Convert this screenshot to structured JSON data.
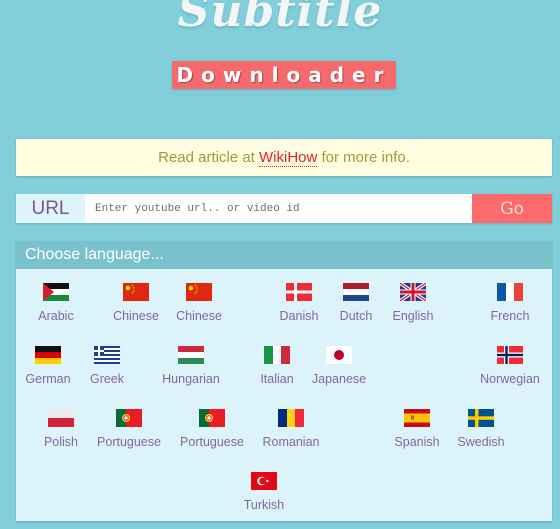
{
  "header": {
    "title": "Subtitle",
    "badge": "Downloader"
  },
  "notice": {
    "prefix": "Read article at ",
    "link": "WikiHow",
    "suffix": " for more info."
  },
  "url_bar": {
    "label": "URL",
    "placeholder": "Enter youtube url.. or video id",
    "value": "",
    "go_label": "Go"
  },
  "languages": {
    "heading": "Choose language...",
    "items": [
      {
        "name": "Arabic",
        "flag": "flag-palestine-icon"
      },
      {
        "name": "Chinese",
        "flag": "flag-china-icon"
      },
      {
        "name": "Chinese",
        "flag": "flag-china-icon"
      },
      {
        "name": "Danish",
        "flag": "flag-denmark-icon"
      },
      {
        "name": "Dutch",
        "flag": "flag-netherlands-icon"
      },
      {
        "name": "English",
        "flag": "flag-uk-icon"
      },
      {
        "name": "French",
        "flag": "flag-france-icon"
      },
      {
        "name": "German",
        "flag": "flag-germany-icon"
      },
      {
        "name": "Greek",
        "flag": "flag-greece-icon"
      },
      {
        "name": "Hungarian",
        "flag": "flag-hungary-icon"
      },
      {
        "name": "Italian",
        "flag": "flag-italy-icon"
      },
      {
        "name": "Japanese",
        "flag": "flag-japan-icon"
      },
      {
        "name": "Norwegian",
        "flag": "flag-norway-icon"
      },
      {
        "name": "Polish",
        "flag": "flag-poland-icon"
      },
      {
        "name": "Portuguese",
        "flag": "flag-portugal-icon"
      },
      {
        "name": "Portuguese",
        "flag": "flag-portugal-icon"
      },
      {
        "name": "Romanian",
        "flag": "flag-romania-icon"
      },
      {
        "name": "Spanish",
        "flag": "flag-spain-icon"
      },
      {
        "name": "Swedish",
        "flag": "flag-sweden-icon"
      },
      {
        "name": "Turkish",
        "flag": "flag-turkey-icon"
      }
    ]
  }
}
